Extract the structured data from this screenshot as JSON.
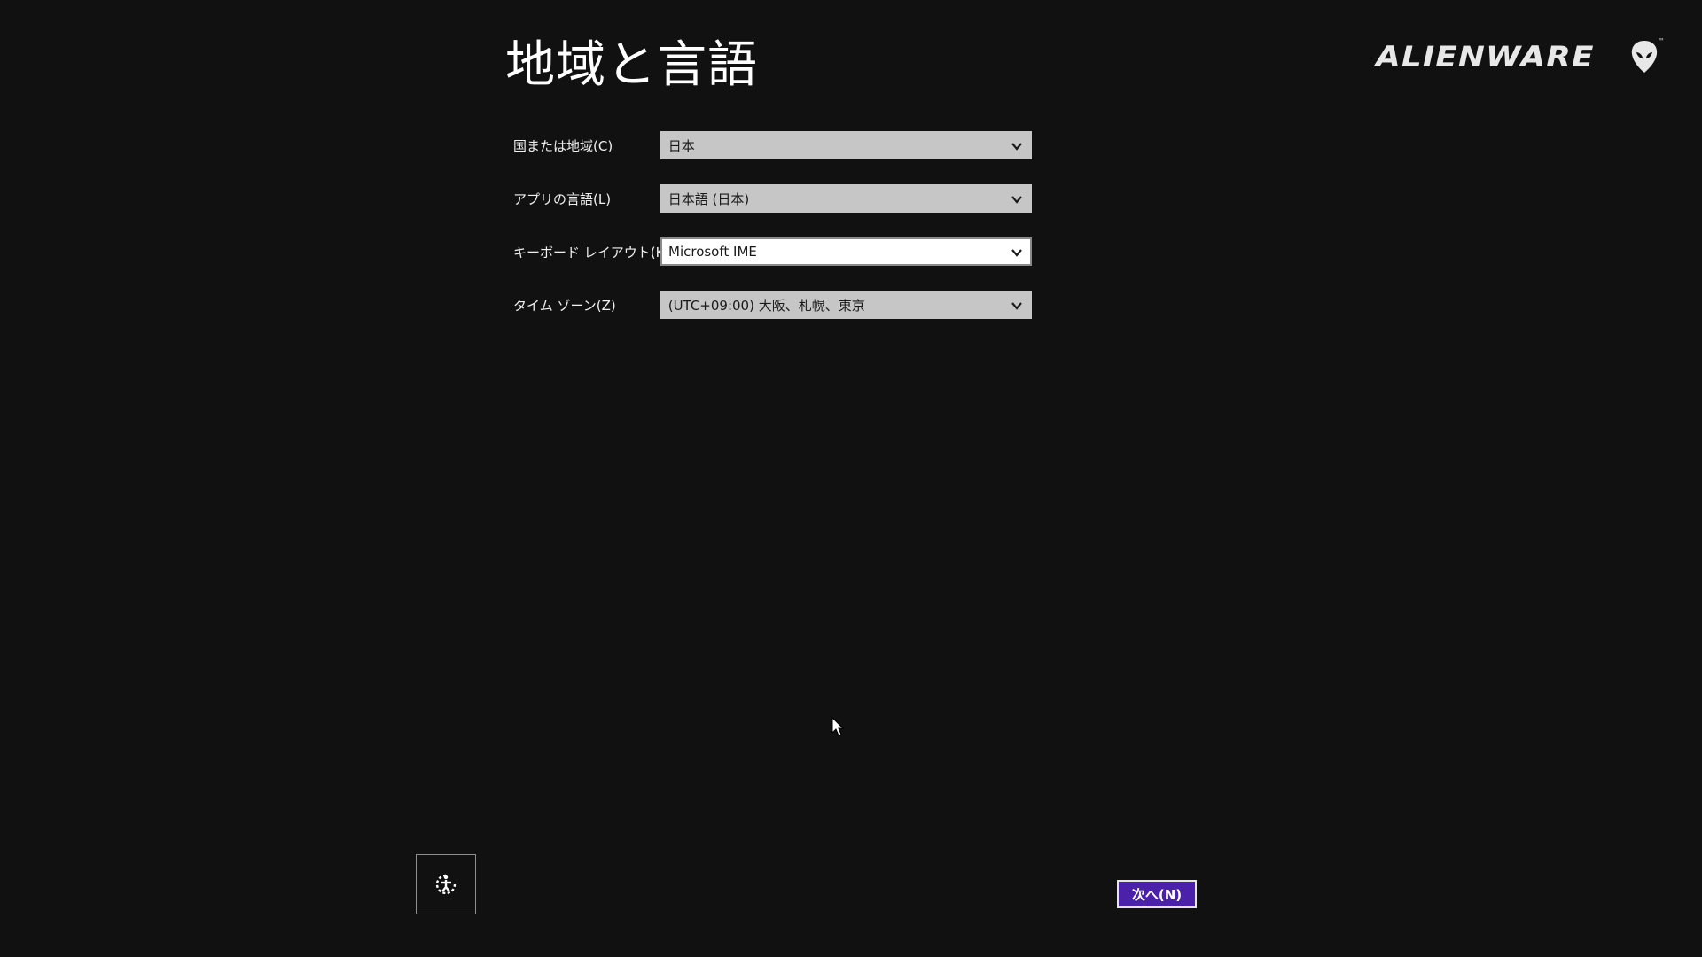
{
  "page": {
    "title": "地域と言語"
  },
  "brand": {
    "logo_text": "ALIENWARE",
    "trademark": "™",
    "icon": "alien-head-icon"
  },
  "form": {
    "fields": [
      {
        "label": "国または地域(C)",
        "value": "日本"
      },
      {
        "label": "アプリの言語(L)",
        "value": "日本語 (日本)"
      },
      {
        "label": "キーボード レイアウト(K)",
        "value": "Microsoft IME"
      },
      {
        "label": "タイム ゾーン(Z)",
        "value": "(UTC+09:00) 大阪、札幌、東京"
      }
    ]
  },
  "footer": {
    "ease_of_access_icon": "ease-of-access-icon",
    "next_label": "次へ(N)"
  },
  "colors": {
    "background": "#111111",
    "select_bg": "#c6c6c6",
    "select_focused_bg": "#ffffff",
    "accent_button": "#4a21a8",
    "text": "#ffffff"
  }
}
